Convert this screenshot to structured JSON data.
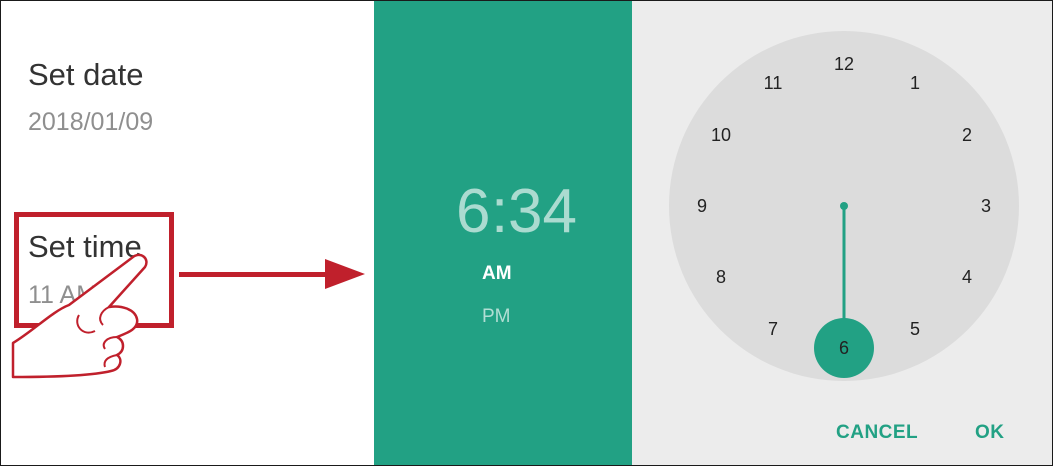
{
  "settings": {
    "date_title": "Set date",
    "date_value": "2018/01/09",
    "time_title": "Set time",
    "time_value": "11 AM"
  },
  "time_header": {
    "hour": "6",
    "separator": ":",
    "minute": "34",
    "am_label": "AM",
    "pm_label": "PM",
    "selected_period": "AM"
  },
  "clock": {
    "numbers": [
      "12",
      "1",
      "2",
      "3",
      "4",
      "5",
      "6",
      "7",
      "8",
      "9",
      "10",
      "11"
    ],
    "selected_number": "6",
    "accent_color": "#22a184"
  },
  "actions": {
    "cancel_label": "CANCEL",
    "ok_label": "OK"
  },
  "annotation_color": "#c0202c"
}
